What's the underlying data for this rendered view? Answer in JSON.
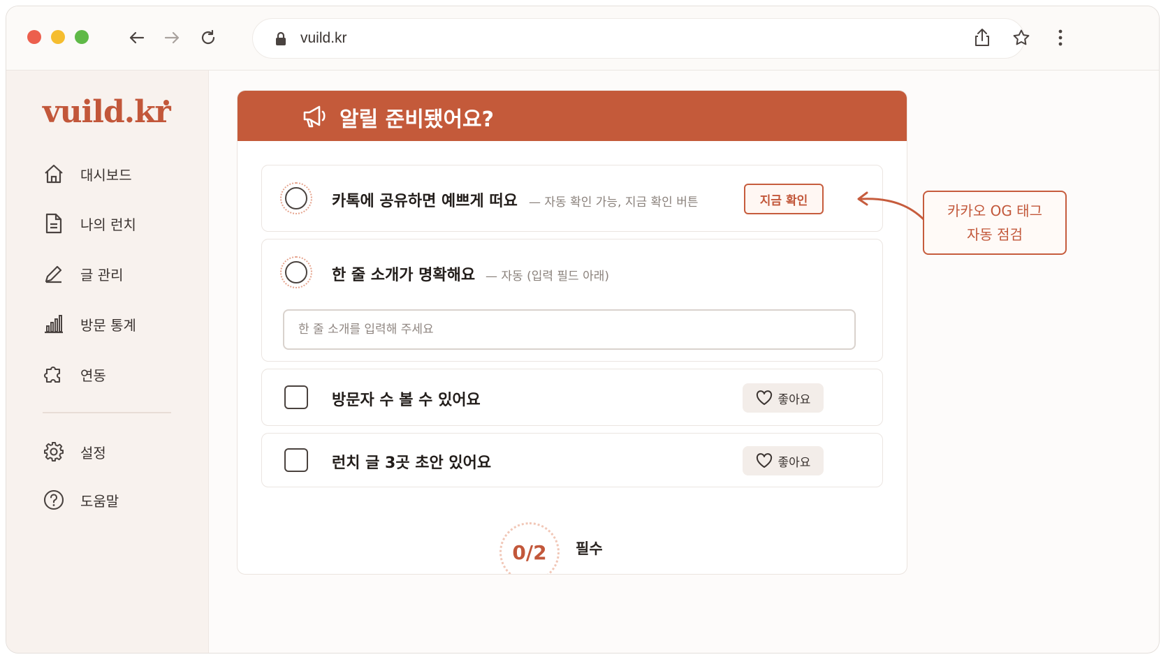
{
  "browser": {
    "url": "vuild.kr"
  },
  "sidebar": {
    "logo": "vuild.kr",
    "items": [
      {
        "label": "대시보드",
        "icon": "home-icon"
      },
      {
        "label": "나의 런치",
        "icon": "document-icon"
      },
      {
        "label": "글 관리",
        "icon": "pencil-icon"
      },
      {
        "label": "방문 통계",
        "icon": "bar-chart-icon"
      },
      {
        "label": "연동",
        "icon": "puzzle-icon"
      }
    ],
    "bottom_items": [
      {
        "label": "설정",
        "icon": "gear-icon"
      },
      {
        "label": "도움말",
        "icon": "help-icon"
      }
    ]
  },
  "panel": {
    "title": "알릴 준비됐어요?",
    "items": [
      {
        "title": "카톡에 공유하면 예쁘게 떠요",
        "note": "— 자동 확인 가능, 지금 확인 버튼",
        "action": "지금 확인",
        "type": "required"
      },
      {
        "title": "한 줄 소개가 명확해요",
        "note": "— 자동 (입력 필드 아래)",
        "input_placeholder": "한 줄 소개를 입력해 주세요",
        "type": "required"
      },
      {
        "title": "방문자 수 볼 수 있어요",
        "action": "좋아요",
        "type": "optional"
      },
      {
        "title": "런치 글 3곳 초안 있어요",
        "action": "좋아요",
        "type": "optional"
      }
    ],
    "progress": {
      "value": "0/2",
      "label": "필수"
    }
  },
  "callout": {
    "line1": "카카오 OG 태그",
    "line2": "자동 점검"
  },
  "colors": {
    "accent": "#c45a3a",
    "sidebar_bg": "#f8f2ee"
  }
}
